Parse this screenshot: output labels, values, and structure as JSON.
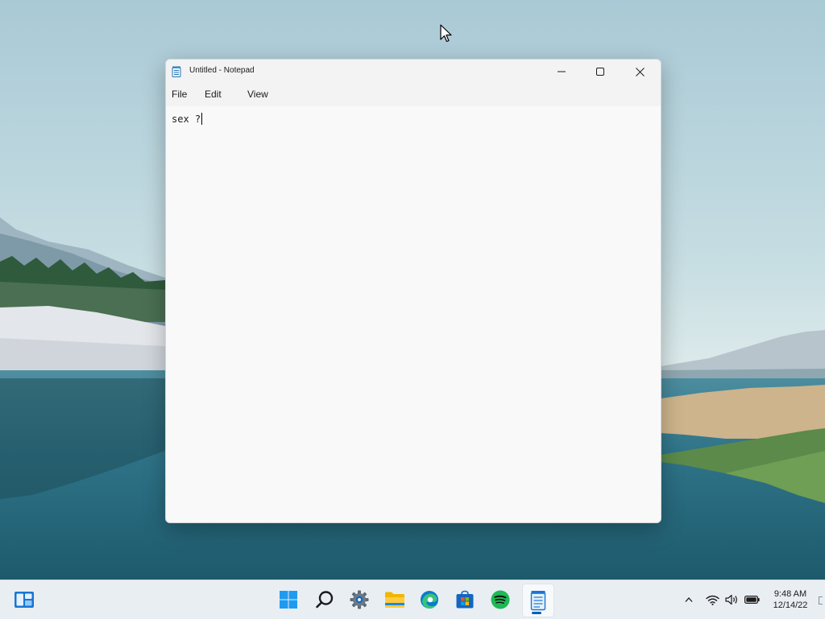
{
  "window": {
    "title": "Untitled - Notepad"
  },
  "menu": {
    "file": "File",
    "edit": "Edit",
    "view": "View"
  },
  "editor": {
    "content": "sex ?"
  },
  "taskbar": {
    "apps": [
      {
        "name": "Widgets",
        "icon": "widgets-icon"
      },
      {
        "name": "Start",
        "icon": "windows-start-icon"
      },
      {
        "name": "Search",
        "icon": "search-icon"
      },
      {
        "name": "Settings",
        "icon": "gear-icon"
      },
      {
        "name": "File Explorer",
        "icon": "folder-icon"
      },
      {
        "name": "Microsoft Edge",
        "icon": "edge-icon"
      },
      {
        "name": "Microsoft Store",
        "icon": "store-icon"
      },
      {
        "name": "Spotify",
        "icon": "spotify-icon"
      },
      {
        "name": "Notepad",
        "icon": "notepad-icon",
        "active": true
      }
    ],
    "tray_icons": [
      "chevron-up-icon",
      "wifi-icon",
      "volume-icon",
      "battery-icon"
    ],
    "clock": {
      "time": "9:48 AM",
      "date": "12/14/22"
    }
  },
  "colors": {
    "accent": "#005fb8",
    "window_bg": "#f9f9f9",
    "titlebar_bg": "#f3f3f3",
    "taskbar_bg": "#e9eef3",
    "spotify_green": "#1db954"
  }
}
